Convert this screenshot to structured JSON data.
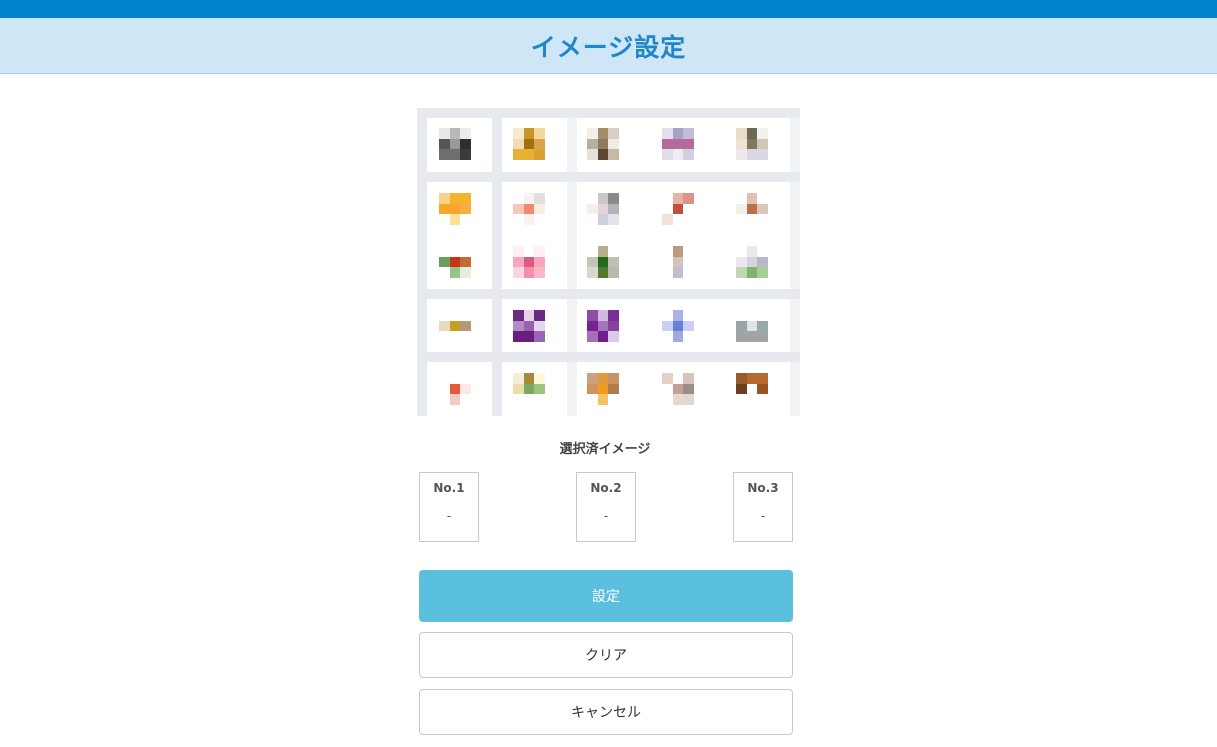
{
  "header": {
    "title": "イメージ設定"
  },
  "colors": {
    "top_bar": "#0082cc",
    "header_bg": "#cfe6f6",
    "title": "#1f86c8",
    "primary_button": "#5bc0de"
  },
  "image_grid": {
    "images": [
      {
        "id": "image-1",
        "pixels": [
          "#e8e8e8",
          "#b8b8b8",
          "#ececec",
          "#555555",
          "#9a9a9a",
          "#2e2e2e",
          "#6e6e6e",
          "#6e6e6e",
          "#3b3b3b"
        ]
      },
      {
        "id": "image-2",
        "pixels": [
          "#f5eccf",
          "#c9952a",
          "#f2d9a0",
          "#f0dcb0",
          "#a0700f",
          "#d9a44a",
          "#e7b233",
          "#e7b233",
          "#d9a12f"
        ]
      },
      {
        "id": "image-3",
        "pixels": [
          "#f2eee8",
          "#a38c6a",
          "#d9cfc2",
          "#b9ad9f",
          "#8e7a5f",
          "#f0ece6",
          "#e6e1da",
          "#5c4630",
          "#c7b9a8"
        ]
      },
      {
        "id": "image-4",
        "pixels": [
          "#e3dfec",
          "#a7a3c6",
          "#c2bed8",
          "#b46a9c",
          "#b46a9c",
          "#b46a9c",
          "#e0dde8",
          "#eeecf2",
          "#d1cfdc"
        ]
      },
      {
        "id": "image-5",
        "pixels": [
          "#e6dcc8",
          "#6b6a55",
          "#f3f1ee",
          "#ece3d3",
          "#86775a",
          "#cfc8b9",
          "#ebe9ee",
          "#dad7e2",
          "#dad7e2"
        ]
      },
      {
        "id": "image-6",
        "pixels": [
          "#fbd08a",
          "#f7b22c",
          "#f7b22c",
          "#f9a826",
          "#f7a632",
          "#f8ad3e",
          "#ffffff",
          "#fde199",
          "#ffffff"
        ]
      },
      {
        "id": "image-7",
        "pixels": [
          "#ffffff",
          "#f7f3f1",
          "#e2e0dc",
          "#f5c7bd",
          "#ef8a6f",
          "#fdebe6",
          "#ffffff",
          "#fdf1ef",
          "#ffffff"
        ]
      },
      {
        "id": "image-8",
        "pixels": [
          "#ffffff",
          "#c8c8cc",
          "#8a8a8e",
          "#f3eef0",
          "#e6d3d8",
          "#b3b3b8",
          "#ffffff",
          "#cfcfdc",
          "#e2e2ea"
        ]
      },
      {
        "id": "image-9",
        "pixels": [
          "#ffffff",
          "#e7b3a6",
          "#d9958a",
          "#ffffff",
          "#c4503c",
          "#ffffff",
          "#f2e0dc",
          "#ffffff",
          "#ffffff"
        ]
      },
      {
        "id": "image-10",
        "pixels": [
          "#ffffff",
          "#e1c2b5",
          "#ffffff",
          "#f4eeec",
          "#b7704d",
          "#dcc5bc",
          "#ffffff",
          "#ffffff",
          "#ffffff"
        ]
      },
      {
        "id": "image-11",
        "pixels": [
          "#ffffff",
          "#ffffff",
          "#ffffff",
          "#66a05a",
          "#c9331a",
          "#c46a33",
          "#ffffff",
          "#96c48a",
          "#e0f0dc"
        ]
      },
      {
        "id": "image-12",
        "pixels": [
          "#ffeef3",
          "#ffffff",
          "#ffeef3",
          "#f7a7bd",
          "#d95a84",
          "#f7a7bd",
          "#fbd6e1",
          "#f38eaa",
          "#fbb6c8"
        ]
      },
      {
        "id": "image-13",
        "pixels": [
          "#ffffff",
          "#b6b08a",
          "#ffffff",
          "#c4c4b8",
          "#1f6b19",
          "#bfc1b0",
          "#d8d8cc",
          "#4f7a2f",
          "#b9b9b1"
        ]
      },
      {
        "id": "image-14",
        "pixels": [
          "#ffffff",
          "#bb9a7f",
          "#ffffff",
          "#ffffff",
          "#d5c3b8",
          "#ffffff",
          "#ffffff",
          "#c2bccb",
          "#ffffff"
        ]
      },
      {
        "id": "image-15",
        "pixels": [
          "#ffffff",
          "#ebe7f0",
          "#ffffff",
          "#ebe7f0",
          "#d7d2e0",
          "#bab7c8",
          "#bcd9b4",
          "#7fb56a",
          "#a6cc98"
        ]
      },
      {
        "id": "image-16",
        "pixels": [
          "#ffffff",
          "#ffffff",
          "#ffffff",
          "#ead9c1",
          "#c8a020",
          "#b09a7a",
          "#ffffff",
          "#ffffff",
          "#ffffff"
        ]
      },
      {
        "id": "image-17",
        "pixels": [
          "#6a2a82",
          "#e2d5ea",
          "#6a2a82",
          "#b38cc7",
          "#9961b0",
          "#e5d7ee",
          "#6a1d7e",
          "#6a1d7e",
          "#9a66b2"
        ]
      },
      {
        "id": "image-18",
        "pixels": [
          "#8e4da8",
          "#d2b8df",
          "#7a2f94",
          "#7a2094",
          "#a475bb",
          "#8a3fa1",
          "#a371ba",
          "#6f1e8a",
          "#dcc9e6"
        ]
      },
      {
        "id": "image-19",
        "pixels": [
          "#ffffff",
          "#a9b3ea",
          "#ffffff",
          "#c9cff5",
          "#6a7fd8",
          "#c9cff5",
          "#ffffff",
          "#9ea9e0",
          "#ffffff"
        ]
      },
      {
        "id": "image-20",
        "pixels": [
          "#ffffff",
          "#ffffff",
          "#ffffff",
          "#99a5a6",
          "#e0e4e4",
          "#98a9a9",
          "#a1a4a4",
          "#a1a4a4",
          "#a1a4a4"
        ]
      },
      {
        "id": "image-21",
        "pixels": [
          "#ffffff",
          "#ffffff",
          "#ffffff",
          "#ffffff",
          "#e65a3a",
          "#fde8e6",
          "#ffffff",
          "#f7c9c2",
          "#ffffff"
        ]
      },
      {
        "id": "image-22",
        "pixels": [
          "#f3eeda",
          "#a88a3d",
          "#fdf7d6",
          "#ecdeaa",
          "#7aaa60",
          "#9cc47e",
          "#ffffff",
          "#ffffff",
          "#ffffff"
        ]
      },
      {
        "id": "image-23",
        "pixels": [
          "#c9a27f",
          "#e09a3a",
          "#c79368",
          "#d1925e",
          "#f39a22",
          "#b17b50",
          "#ffffff",
          "#f6c35f",
          "#ffffff"
        ]
      },
      {
        "id": "image-24",
        "pixels": [
          "#e6cfc4",
          "#ffffff",
          "#d9c3bd",
          "#ffffff",
          "#c5a093",
          "#9a8d8b",
          "#ffffff",
          "#e6d7d0",
          "#e3d6cf"
        ]
      },
      {
        "id": "image-25",
        "pixels": [
          "#9b5a2c",
          "#b86a2e",
          "#b86a2e",
          "#6e3d22",
          "#ffffff",
          "#9b5225",
          "#ffffff",
          "#ffffff",
          "#ffffff"
        ]
      }
    ]
  },
  "selected": {
    "label": "選択済イメージ",
    "slots": [
      {
        "title": "No.1",
        "value": "-"
      },
      {
        "title": "No.2",
        "value": "-"
      },
      {
        "title": "No.3",
        "value": "-"
      }
    ]
  },
  "buttons": {
    "set_label": "設定",
    "clear_label": "クリア",
    "cancel_label": "キャンセル"
  }
}
